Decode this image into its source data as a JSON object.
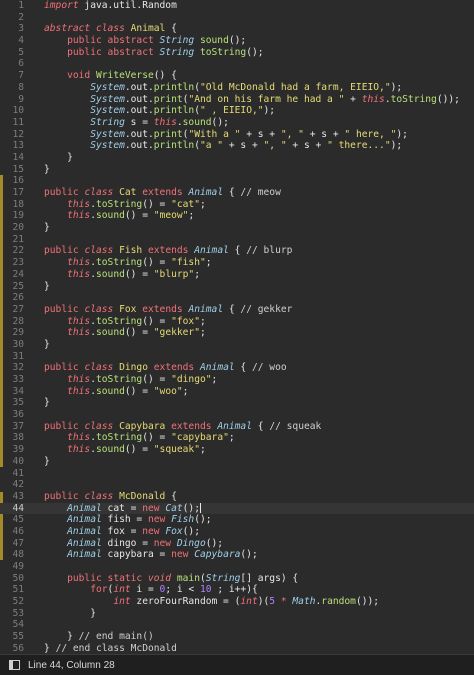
{
  "status_bar": {
    "position": "Line 44, Column 28",
    "panel_icon": "panel-toggle-icon"
  },
  "editor": {
    "current_line": 44,
    "lines": [
      {
        "n": "1",
        "html": "<span class=\"kwi\">import</span> java.util.Random"
      },
      {
        "n": "2",
        "html": ""
      },
      {
        "n": "3",
        "html": "<span class=\"kwi\">abstract class</span> <span class=\"cls\">Animal</span> {"
      },
      {
        "n": "4",
        "html": "    <span class=\"kw\">public abstract</span> <span class=\"ital\">String</span> <span class=\"mth\">sound</span>();"
      },
      {
        "n": "5",
        "html": "    <span class=\"kw\">public abstract</span> <span class=\"ital\">String</span> <span class=\"mth\">toString</span>();"
      },
      {
        "n": "6",
        "html": ""
      },
      {
        "n": "7",
        "html": "    <span class=\"kw\">void</span> <span class=\"mth\">WriteVerse</span>() {"
      },
      {
        "n": "8",
        "html": "        <span class=\"ital\">System</span>.out.<span class=\"mth\">println</span>(<span class=\"str\">\"Old McDonald had a farm, EIEIO,\"</span>);"
      },
      {
        "n": "9",
        "html": "        <span class=\"ital\">System</span>.out.<span class=\"mth\">print</span>(<span class=\"str\">\"And on his farm he had a \"</span> + <span class=\"kwi\">this</span>.<span class=\"mth\">toString</span>());"
      },
      {
        "n": "10",
        "html": "        <span class=\"ital\">System</span>.out.<span class=\"mth\">println</span>(<span class=\"str\">\" , EIEIO,\"</span>);"
      },
      {
        "n": "11",
        "html": "        <span class=\"ital\">String</span> s = <span class=\"kwi\">this</span>.<span class=\"mth\">sound</span>();"
      },
      {
        "n": "12",
        "html": "        <span class=\"ital\">System</span>.out.<span class=\"mth\">print</span>(<span class=\"str\">\"With a \"</span> + s + <span class=\"str\">\", \"</span> + s + <span class=\"str\">\" here, \"</span>);"
      },
      {
        "n": "13",
        "html": "        <span class=\"ital\">System</span>.out.<span class=\"mth\">println</span>(<span class=\"str\">\"a \"</span> + s + <span class=\"str\">\", \"</span> + s + <span class=\"str\">\" there...\"</span>);"
      },
      {
        "n": "14",
        "html": "    }"
      },
      {
        "n": "15",
        "html": "}"
      },
      {
        "n": "16",
        "html": ""
      },
      {
        "n": "17",
        "html": "<span class=\"kw\">public</span> <span class=\"kwi\">class</span> <span class=\"cls\">Cat</span> <span class=\"kw\">extends</span> <span class=\"ital\">Animal</span> { <span class=\"cmt\">// meow</span>"
      },
      {
        "n": "18",
        "html": "    <span class=\"kwi\">this</span>.<span class=\"mth\">toString</span>() = <span class=\"str\">\"cat\"</span>;"
      },
      {
        "n": "19",
        "html": "    <span class=\"kwi\">this</span>.<span class=\"mth\">sound</span>() = <span class=\"str\">\"meow\"</span>;"
      },
      {
        "n": "20",
        "html": "}"
      },
      {
        "n": "21",
        "html": ""
      },
      {
        "n": "22",
        "html": "<span class=\"kw\">public</span> <span class=\"kwi\">class</span> <span class=\"cls\">Fish</span> <span class=\"kw\">extends</span> <span class=\"ital\">Animal</span> { <span class=\"cmt\">// blurp</span>"
      },
      {
        "n": "23",
        "html": "    <span class=\"kwi\">this</span>.<span class=\"mth\">toString</span>() = <span class=\"str\">\"fish\"</span>;"
      },
      {
        "n": "24",
        "html": "    <span class=\"kwi\">this</span>.<span class=\"mth\">sound</span>() = <span class=\"str\">\"blurp\"</span>;"
      },
      {
        "n": "25",
        "html": "}"
      },
      {
        "n": "26",
        "html": ""
      },
      {
        "n": "27",
        "html": "<span class=\"kw\">public</span> <span class=\"kwi\">class</span> <span class=\"cls\">Fox</span> <span class=\"kw\">extends</span> <span class=\"ital\">Animal</span> { <span class=\"cmt\">// gekker</span>"
      },
      {
        "n": "28",
        "html": "    <span class=\"kwi\">this</span>.<span class=\"mth\">toString</span>() = <span class=\"str\">\"fox\"</span>;"
      },
      {
        "n": "29",
        "html": "    <span class=\"kwi\">this</span>.<span class=\"mth\">sound</span>() = <span class=\"str\">\"gekker\"</span>;"
      },
      {
        "n": "30",
        "html": "}"
      },
      {
        "n": "31",
        "html": ""
      },
      {
        "n": "32",
        "html": "<span class=\"kw\">public</span> <span class=\"kwi\">class</span> <span class=\"cls\">Dingo</span> <span class=\"kw\">extends</span> <span class=\"ital\">Animal</span> { <span class=\"cmt\">// woo</span>"
      },
      {
        "n": "33",
        "html": "    <span class=\"kwi\">this</span>.<span class=\"mth\">toString</span>() = <span class=\"str\">\"dingo\"</span>;"
      },
      {
        "n": "34",
        "html": "    <span class=\"kwi\">this</span>.<span class=\"mth\">sound</span>() = <span class=\"str\">\"woo\"</span>;"
      },
      {
        "n": "35",
        "html": "}"
      },
      {
        "n": "36",
        "html": ""
      },
      {
        "n": "37",
        "html": "<span class=\"kw\">public</span> <span class=\"kwi\">class</span> <span class=\"cls\">Capybara</span> <span class=\"kw\">extends</span> <span class=\"ital\">Animal</span> { <span class=\"cmt\">// squeak</span>"
      },
      {
        "n": "38",
        "html": "    <span class=\"kwi\">this</span>.<span class=\"mth\">toString</span>() = <span class=\"str\">\"capybara\"</span>;"
      },
      {
        "n": "39",
        "html": "    <span class=\"kwi\">this</span>.<span class=\"mth\">sound</span>() = <span class=\"str\">\"squeak\"</span>;"
      },
      {
        "n": "40",
        "html": "}"
      },
      {
        "n": "41",
        "html": ""
      },
      {
        "n": "42",
        "html": ""
      },
      {
        "n": "43",
        "html": "<span class=\"kw\">public</span> <span class=\"kwi\">class</span> <span class=\"cls\">McDonald</span> {"
      },
      {
        "n": "44",
        "html": "    <span class=\"ital\">Animal</span> cat = <span class=\"kw\">new</span> <span class=\"ital\">Cat</span>();<span class=\"cursor\"></span>"
      },
      {
        "n": "45",
        "html": "    <span class=\"ital\">Animal</span> fish = <span class=\"kw\">new</span> <span class=\"ital\">Fish</span>();"
      },
      {
        "n": "46",
        "html": "    <span class=\"ital\">Animal</span> fox = <span class=\"kw\">new</span> <span class=\"ital\">Fox</span>();"
      },
      {
        "n": "47",
        "html": "    <span class=\"ital\">Animal</span> dingo = <span class=\"kw\">new</span> <span class=\"ital\">Dingo</span>();"
      },
      {
        "n": "48",
        "html": "    <span class=\"ital\">Animal</span> capybara = <span class=\"kw\">new</span> <span class=\"ital\">Capybara</span>();"
      },
      {
        "n": "49",
        "html": ""
      },
      {
        "n": "50",
        "html": "    <span class=\"kw\">public static</span> <span class=\"kwi\">void</span> <span class=\"mth\">main</span>(<span class=\"ital\">String</span>[] args) {"
      },
      {
        "n": "51",
        "html": "        <span class=\"kw\">for</span>(<span class=\"kwi\">int</span> i = <span class=\"num\">0</span>; i &lt; <span class=\"num\">10</span> ; i++){"
      },
      {
        "n": "52",
        "html": "            <span class=\"kwi\">int</span> zeroFourRandom = (<span class=\"kwi\">int</span>)(<span class=\"num\">5</span> <span class=\"kw\">*</span> <span class=\"ital\">Math</span>.<span class=\"mth\">random</span>());"
      },
      {
        "n": "53",
        "html": "        }"
      },
      {
        "n": "54",
        "html": ""
      },
      {
        "n": "55",
        "html": "    } <span class=\"cmt\">// end main()</span>"
      },
      {
        "n": "56",
        "html": "} <span class=\"cmt\">// end class McDonald</span>"
      }
    ]
  }
}
